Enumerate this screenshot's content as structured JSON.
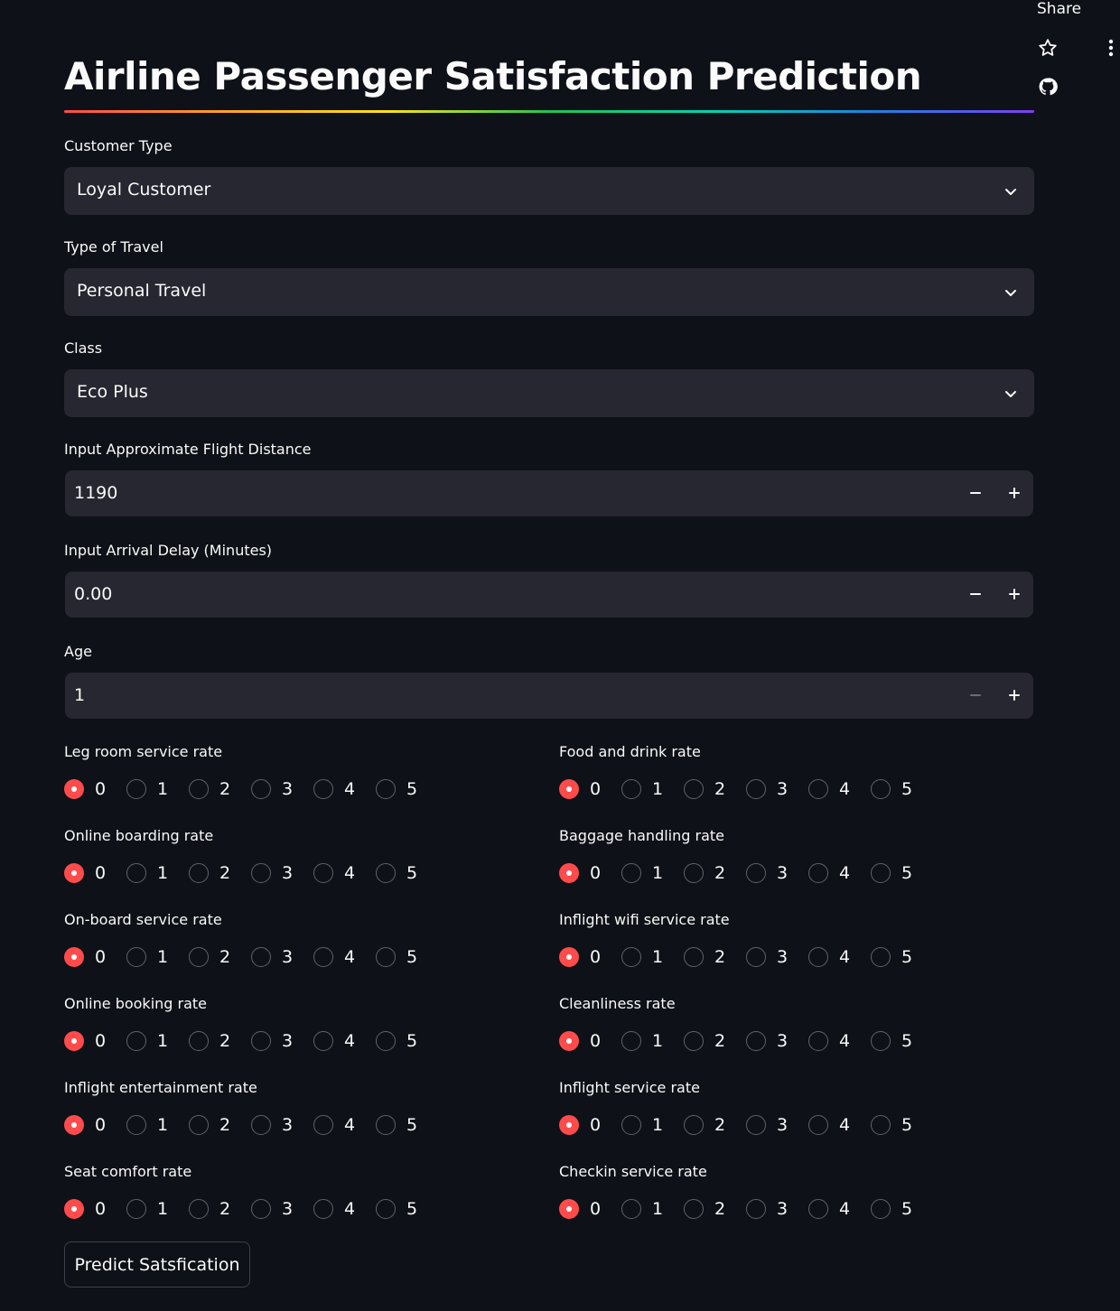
{
  "toolbar": {
    "share_label": "Share"
  },
  "title": "Airline Passenger Satisfaction Prediction",
  "selects": [
    {
      "label": "Customer Type",
      "value": "Loyal Customer"
    },
    {
      "label": "Type of Travel",
      "value": "Personal Travel"
    },
    {
      "label": "Class",
      "value": "Eco Plus"
    }
  ],
  "number_inputs": [
    {
      "label": "Input Approximate Flight Distance",
      "value": "1190",
      "minus_enabled": true
    },
    {
      "label": "Input Arrival Delay (Minutes)",
      "value": "0.00",
      "minus_enabled": true
    },
    {
      "label": "Age",
      "value": "1",
      "minus_enabled": false
    }
  ],
  "radio_options": [
    "0",
    "1",
    "2",
    "3",
    "4",
    "5"
  ],
  "rating_left": [
    {
      "label": "Leg room service rate",
      "selected": "0"
    },
    {
      "label": "Online boarding rate",
      "selected": "0"
    },
    {
      "label": "On-board service rate",
      "selected": "0"
    },
    {
      "label": "Online booking rate",
      "selected": "0"
    },
    {
      "label": "Inflight entertainment rate",
      "selected": "0"
    },
    {
      "label": "Seat comfort rate",
      "selected": "0"
    }
  ],
  "rating_right": [
    {
      "label": "Food and drink rate",
      "selected": "0"
    },
    {
      "label": "Baggage handling rate",
      "selected": "0"
    },
    {
      "label": "Inflight wifi service rate",
      "selected": "0"
    },
    {
      "label": "Cleanliness rate",
      "selected": "0"
    },
    {
      "label": "Inflight service rate",
      "selected": "0"
    },
    {
      "label": "Checkin service rate",
      "selected": "0"
    }
  ],
  "predict_button": "Predict Satsfication",
  "colors": {
    "accent": "#ff4b4b",
    "background": "#0e1117",
    "widget_bg": "#262730",
    "text": "#fafafa"
  },
  "icons": {
    "star": "star-icon",
    "github": "github-icon",
    "menu": "kebab-menu-icon",
    "chevron": "chevron-down-icon",
    "minus": "minus-icon",
    "plus": "plus-icon"
  }
}
